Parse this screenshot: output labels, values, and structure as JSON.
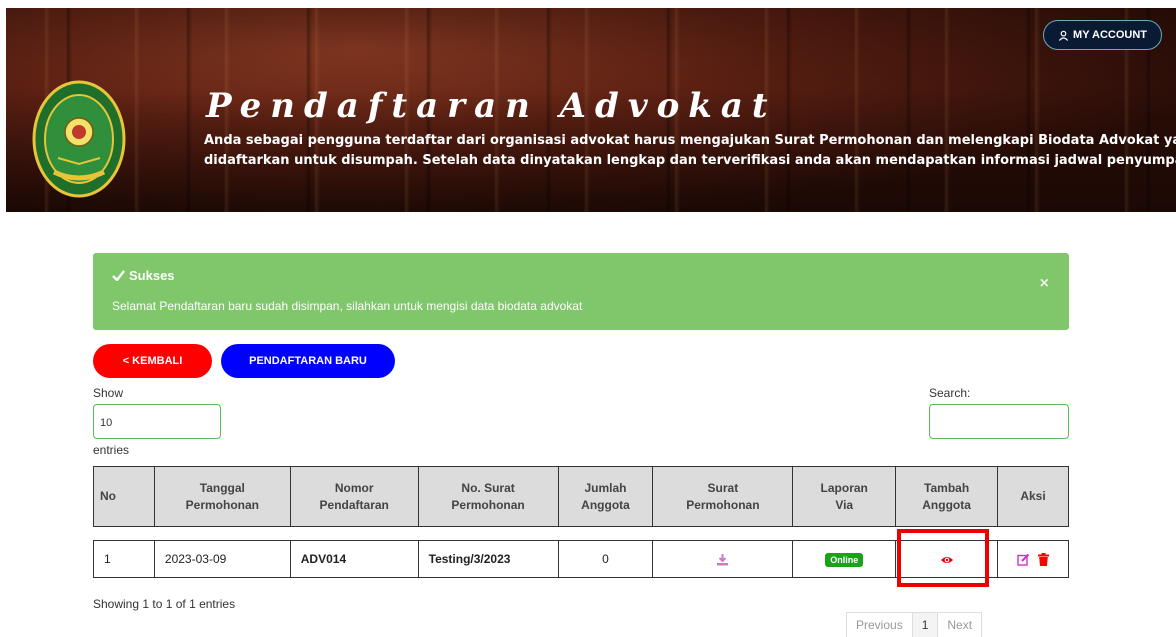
{
  "header": {
    "title": "Pendaftaran Advokat",
    "desc_line1": "Anda sebagai pengguna terdaftar dari organisasi advokat harus mengajukan Surat Permohonan dan melengkapi Biodata Advokat yang akan",
    "desc_line2": "didaftarkan untuk disumpah. Setelah data dinyatakan lengkap dan terverifikasi anda akan mendapatkan informasi jadwal penyumpahan.",
    "my_account": "MY ACCOUNT"
  },
  "alert": {
    "title": "Sukses",
    "message": "Selamat Pendaftaran baru sudah disimpan, silahkan untuk mengisi data biodata advokat",
    "close": "×"
  },
  "buttons": {
    "back": "< KEMBALI",
    "new": "PENDAFTARAN BARU"
  },
  "controls": {
    "show_label": "Show",
    "page_length": "10",
    "entries_label": "entries",
    "search_label": "Search:",
    "search_value": ""
  },
  "table": {
    "headers": {
      "no": "No",
      "tanggal_1": "Tanggal",
      "tanggal_2": "Permohonan",
      "nomor_1": "Nomor",
      "nomor_2": "Pendaftaran",
      "surat_no_1": "No. Surat",
      "surat_no_2": "Permohonan",
      "jumlah_1": "Jumlah",
      "jumlah_2": "Anggota",
      "surat_1": "Surat",
      "surat_2": "Permohonan",
      "laporan_1": "Laporan",
      "laporan_2": "Via",
      "tambah_1": "Tambah",
      "tambah_2": "Anggota",
      "aksi": "Aksi"
    },
    "rows": [
      {
        "no": "1",
        "tanggal": "2023-03-09",
        "nomor": "ADV014",
        "no_surat": "Testing/3/2023",
        "jumlah": "0",
        "laporan": "Online"
      }
    ]
  },
  "footer": {
    "info": "Showing 1 to 1 of 1 entries",
    "prev": "Previous",
    "page": "1",
    "next": "Next"
  },
  "colors": {
    "alert_bg": "#80c66b",
    "back_button": "#ff0000",
    "new_button": "#0000ff",
    "highlight": "#ee0000",
    "online_badge": "#1aa31a",
    "download_icon": "#c77dc7",
    "eye_icon": "#e60000",
    "edit_icon": "#cc33cc",
    "delete_icon": "#ff0000"
  },
  "icons": {
    "account": "user-icon",
    "alert": "check-icon",
    "download": "download-icon",
    "view": "eye-icon",
    "edit": "edit-icon",
    "delete": "trash-icon"
  }
}
